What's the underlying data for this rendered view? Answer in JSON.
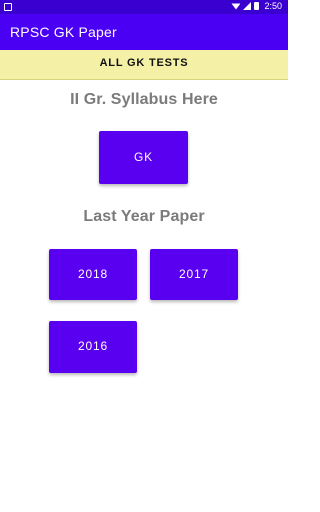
{
  "status_bar": {
    "time": "2:50",
    "icons": [
      "notification-icon",
      "wifi-icon",
      "signal-icon",
      "battery-icon"
    ]
  },
  "app_bar": {
    "title": "RPSC GK Paper"
  },
  "banner": {
    "label": "ALL GK TESTS"
  },
  "syllabus": {
    "heading": "II Gr. Syllabus Here",
    "button_label": "GK"
  },
  "last_year": {
    "heading": "Last Year Paper",
    "buttons": [
      "2018",
      "2017",
      "2016"
    ]
  },
  "colors": {
    "status_bar": "#3a00d0",
    "app_bar": "#4a00f2",
    "banner": "#f4f1a6",
    "button": "#5a00f0",
    "heading_text": "#7b7b7b"
  }
}
